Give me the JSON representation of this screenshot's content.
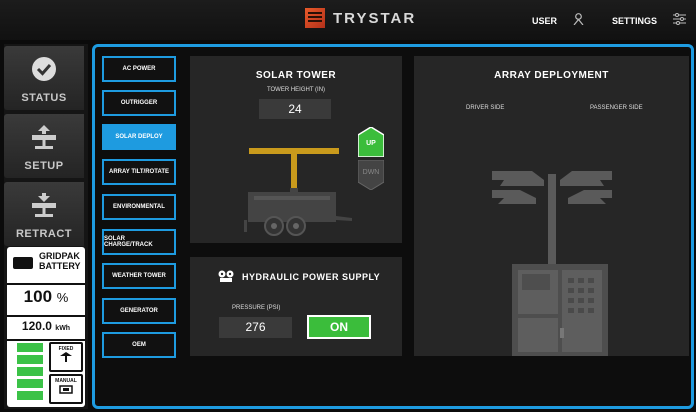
{
  "brand": {
    "name": "TRYSTAR"
  },
  "topnav": {
    "user_label": "USER",
    "settings_label": "SETTINGS"
  },
  "sidebar": {
    "items": [
      {
        "label": "STATUS",
        "icon": "check-circle-icon"
      },
      {
        "label": "SETUP",
        "icon": "solar-tower-up-icon"
      },
      {
        "label": "RETRACT",
        "icon": "solar-tower-down-icon"
      }
    ]
  },
  "battery": {
    "name_line1": "GRIDPAK",
    "name_line2": "BATTERY",
    "percent": "100",
    "percent_unit": "%",
    "energy": "120.0",
    "energy_unit": "kWh",
    "level_bars": 5,
    "modes": [
      {
        "label": "FIXED",
        "icon": "array-fixed-icon"
      },
      {
        "label": "MANUAL",
        "icon": "manual-icon"
      }
    ]
  },
  "menu": {
    "items": [
      {
        "label": "AC POWER",
        "active": false
      },
      {
        "label": "OUTRIGGER",
        "active": false
      },
      {
        "label": "SOLAR DEPLOY",
        "active": true
      },
      {
        "label": "ARRAY TILT/ROTATE",
        "active": false
      },
      {
        "label": "ENVIRONMENTAL",
        "active": false
      },
      {
        "label": "SOLAR CHARGE/TRACK",
        "active": false
      },
      {
        "label": "WEATHER TOWER",
        "active": false
      },
      {
        "label": "GENERATOR",
        "active": false
      },
      {
        "label": "OEM",
        "active": false
      }
    ]
  },
  "solar_tower": {
    "title": "SOLAR TOWER",
    "height_label": "TOWER HEIGHT (IN)",
    "height_value": "24",
    "up_label": "UP",
    "down_label": "DWN"
  },
  "hydraulic": {
    "title": "HYDRAULIC POWER SUPPLY",
    "pressure_label": "PRESSURE (PSI)",
    "pressure_value": "276",
    "state_label": "ON"
  },
  "array_deployment": {
    "title": "ARRAY DEPLOYMENT",
    "driver_label": "DRIVER SIDE",
    "passenger_label": "PASSENGER SIDE"
  },
  "colors": {
    "accent": "#1e9be0",
    "green": "#3bbd3b",
    "mast": "#c99a1c"
  }
}
